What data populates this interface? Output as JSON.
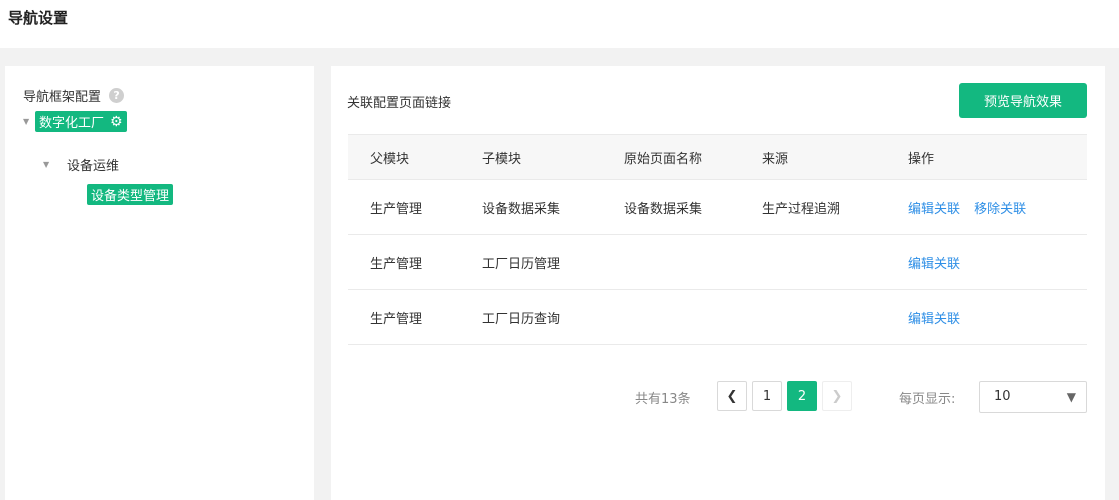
{
  "page": {
    "title": "导航设置"
  },
  "tree": {
    "header": "导航框架配置",
    "help_icon": "question-icon",
    "root": {
      "label": "数字化工厂",
      "icon": "gear-icon"
    },
    "child": {
      "label": "设备运维"
    },
    "leaf": {
      "label": "设备类型管理"
    }
  },
  "main": {
    "section_title": "关联配置页面链接",
    "preview_button": "预览导航效果",
    "table": {
      "headers": [
        "父模块",
        "子模块",
        "原始页面名称",
        "来源",
        "操作"
      ],
      "rows": [
        {
          "parent": "生产管理",
          "child": "设备数据采集",
          "original": "设备数据采集",
          "source": "生产过程追溯",
          "edit": "编辑关联",
          "remove": "移除关联"
        },
        {
          "parent": "生产管理",
          "child": "工厂日历管理",
          "original": "",
          "source": "",
          "edit": "编辑关联",
          "remove": ""
        },
        {
          "parent": "生产管理",
          "child": "工厂日历查询",
          "original": "",
          "source": "",
          "edit": "编辑关联",
          "remove": ""
        }
      ]
    },
    "pagination": {
      "total_text": "共有13条",
      "prev_icon": "chevron-left-icon",
      "pages": [
        "1",
        "2"
      ],
      "current_page": "2",
      "next_icon": "chevron-right-icon",
      "per_page_label": "每页显示:",
      "per_page_value": "10",
      "select_icon": "triangle-down-icon"
    }
  },
  "colors": {
    "accent": "#13b880",
    "link": "#2f8fe6"
  }
}
